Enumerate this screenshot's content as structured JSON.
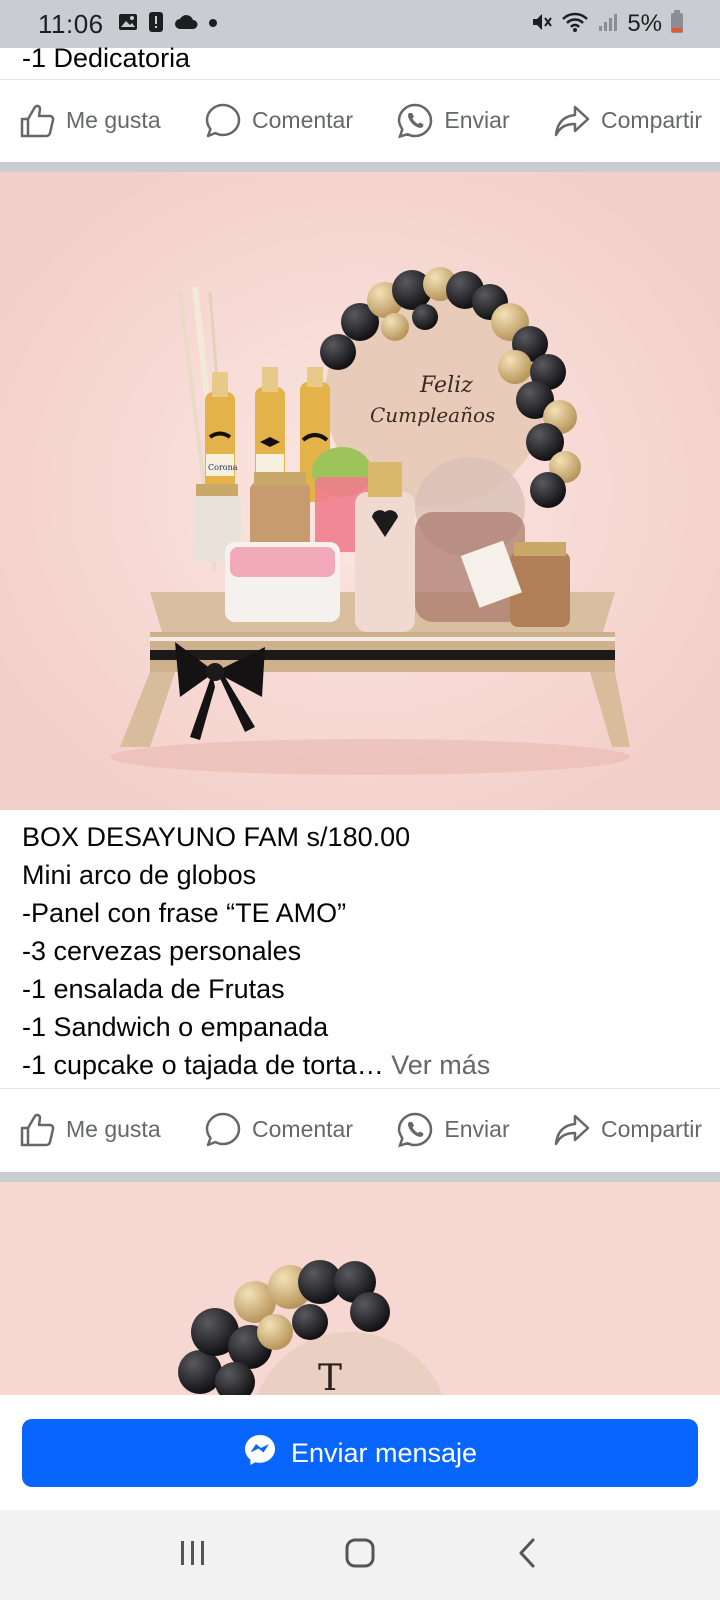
{
  "status_bar": {
    "time": "11:06",
    "battery": "5%",
    "icons": [
      "gallery-icon",
      "alert-icon",
      "cloud-icon",
      "dot-icon",
      "mute-icon",
      "wifi-icon",
      "signal-icon",
      "battery-icon"
    ]
  },
  "post_top": {
    "last_line": "-1 Dedicatoria"
  },
  "actions": {
    "like": "Me gusta",
    "comment": "Comentar",
    "send": "Enviar",
    "share": "Compartir"
  },
  "post_main": {
    "title": "BOX DESAYUNO FAM s/180.00",
    "lines": [
      "Mini arco de globos",
      "-Panel con frase “TE AMO”",
      "-3 cervezas personales",
      "-1 ensalada de Frutas",
      "-1 Sandwich o empanada",
      "-1 cupcake o tajada de torta…"
    ],
    "see_more": " Ver más",
    "photo_text": "Feliz Cumpleaños",
    "bottle_label": "Corona"
  },
  "next_photo": {
    "photo_text": "T"
  },
  "cta": {
    "label": "Enviar mensaje",
    "color": "#0866ff"
  },
  "nav": {
    "buttons": [
      "recent-apps-icon",
      "home-icon",
      "back-icon"
    ]
  },
  "colors": {
    "status_bar_bg": "#c9ccd1",
    "photo_bg": "#f6d7d2",
    "action_text": "#65676b"
  }
}
